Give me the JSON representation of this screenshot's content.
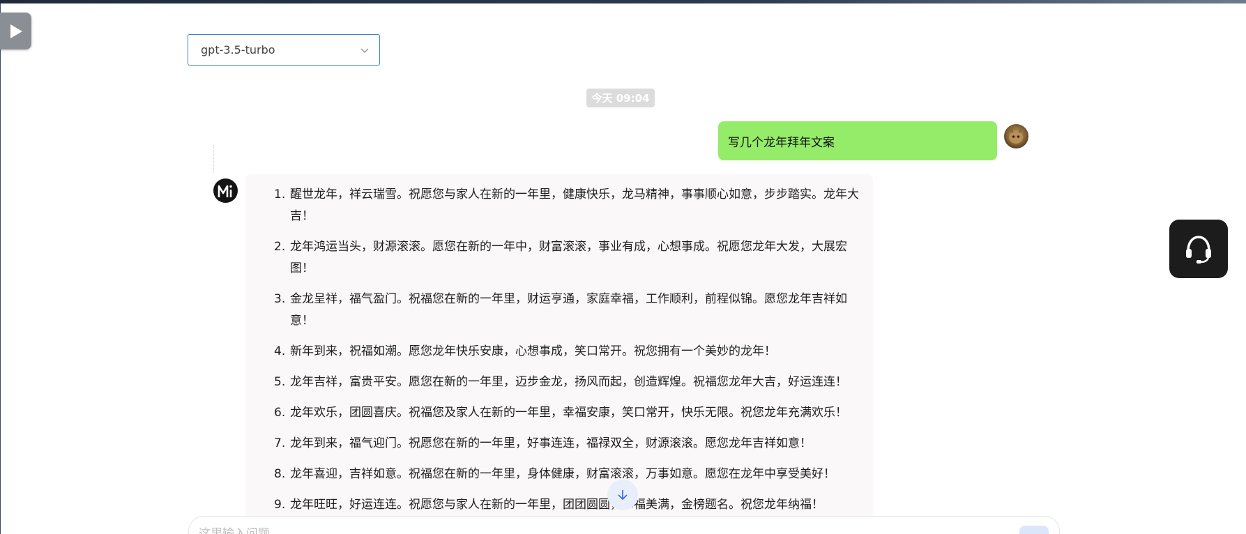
{
  "model_select": {
    "value": "gpt-3.5-turbo"
  },
  "chat": {
    "timestamp": "今天 09:04",
    "user_message": "写几个龙年拜年文案",
    "assistant_items": [
      {
        "num": "1.",
        "text": "醒世龙年，祥云瑞雪。祝愿您与家人在新的一年里，健康快乐，龙马精神，事事顺心如意，步步踏实。龙年大吉！"
      },
      {
        "num": "2.",
        "text": "龙年鸿运当头，财源滚滚。愿您在新的一年中，财富滚滚，事业有成，心想事成。祝愿您龙年大发，大展宏图！"
      },
      {
        "num": "3.",
        "text": "金龙呈祥，福气盈门。祝福您在新的一年里，财运亨通，家庭幸福，工作顺利，前程似锦。愿您龙年吉祥如意！"
      },
      {
        "num": "4.",
        "text": "新年到来，祝福如潮。愿您龙年快乐安康，心想事成，笑口常开。祝您拥有一个美妙的龙年！"
      },
      {
        "num": "5.",
        "text": "龙年吉祥，富贵平安。愿您在新的一年里，迈步金龙，扬风而起，创造辉煌。祝福您龙年大吉，好运连连！"
      },
      {
        "num": "6.",
        "text": "龙年欢乐，团圆喜庆。祝福您及家人在新的一年里，幸福安康，笑口常开，快乐无限。祝您龙年充满欢乐！"
      },
      {
        "num": "7.",
        "text": "龙年到来，福气迎门。祝愿您在新的一年里，好事连连，福禄双全，财源滚滚。愿您龙年吉祥如意！"
      },
      {
        "num": "8.",
        "text": "龙年喜迎，吉祥如意。祝福您在新的一年里，身体健康，财富滚滚，万事如意。愿您在龙年中享受美好！"
      },
      {
        "num": "9.",
        "text": "龙年旺旺，好运连连。祝愿您与家人在新的一年里，团团圆圆，幸福美满，金榜题名。祝您龙年纳福！"
      }
    ]
  },
  "input": {
    "placeholder": "这里输入问题"
  },
  "icons": {
    "sidebar_toggle": "play-triangle-icon",
    "dropdown": "chevron-down-icon",
    "scroll_down": "arrow-down-icon",
    "support": "headset-icon",
    "bot_avatar": "mi-logo-icon",
    "user_avatar": "cat-photo-avatar"
  },
  "colors": {
    "user_bubble": "#95ec69",
    "accent_blue": "#3b82d6",
    "support_bg": "#1c1c1c"
  }
}
